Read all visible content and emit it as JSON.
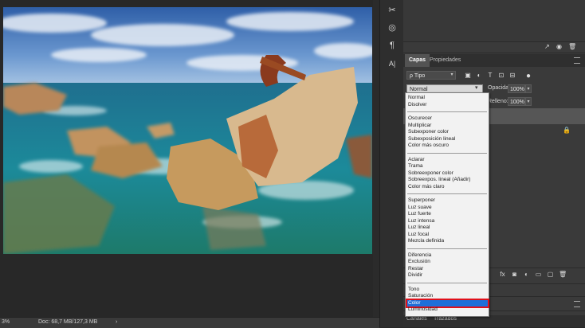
{
  "status_bar": {
    "zoom": "3%",
    "doc_info": "Doc: 68,7 MB/127,3 MB",
    "arrow": "›"
  },
  "tool_icons": [
    "scissors-icon",
    "circle-icon",
    "paragraph-icon",
    "character-icon"
  ],
  "tool_glyphs": {
    "scissors": "✂",
    "circle": "◎",
    "paragraph": "¶",
    "character": "A|"
  },
  "panel": {
    "tabs": [
      "Capas",
      "Propiedades"
    ],
    "filter": {
      "value": "ρ Tipo"
    },
    "filter_icons": [
      "▣",
      "◐",
      "T",
      "⊡",
      "⊟"
    ],
    "blend_mode": "Normal",
    "opacity_label": "Opacidad:",
    "opacity_value": "100%",
    "fill_label": "Relleno:",
    "fill_value": "100%",
    "lock": "🔒",
    "bottom_icons": [
      "fx",
      "◙",
      "◐",
      "▭",
      "▢",
      "🗑"
    ],
    "top_icons": [
      "↗",
      "◉",
      "🗑"
    ],
    "lower_tabs": [
      "Canales",
      "Trazados"
    ]
  },
  "dropdown": {
    "groups": [
      [
        "Normal",
        "Disolver"
      ],
      [
        "Oscurecer",
        "Multiplicar",
        "Subexponer color",
        "Subexposición lineal",
        "Color más oscuro"
      ],
      [
        "Aclarar",
        "Trama",
        "Sobreexponer color",
        "Sobreexpos. lineal (Añadir)",
        "Color más claro"
      ],
      [
        "Superponer",
        "Luz suave",
        "Luz fuerte",
        "Luz intensa",
        "Luz lineal",
        "Luz focal",
        "Mezcla definida"
      ],
      [
        "Diferencia",
        "Exclusión",
        "Restar",
        "Dividir"
      ],
      [
        "Tono",
        "Saturación",
        "Color",
        "Luminosidad"
      ]
    ],
    "selected": "Color"
  },
  "colors": {
    "selected_bg": "#1e6fd9",
    "highlight_border": "#e0101a",
    "panel_bg": "#3a3a3a"
  }
}
